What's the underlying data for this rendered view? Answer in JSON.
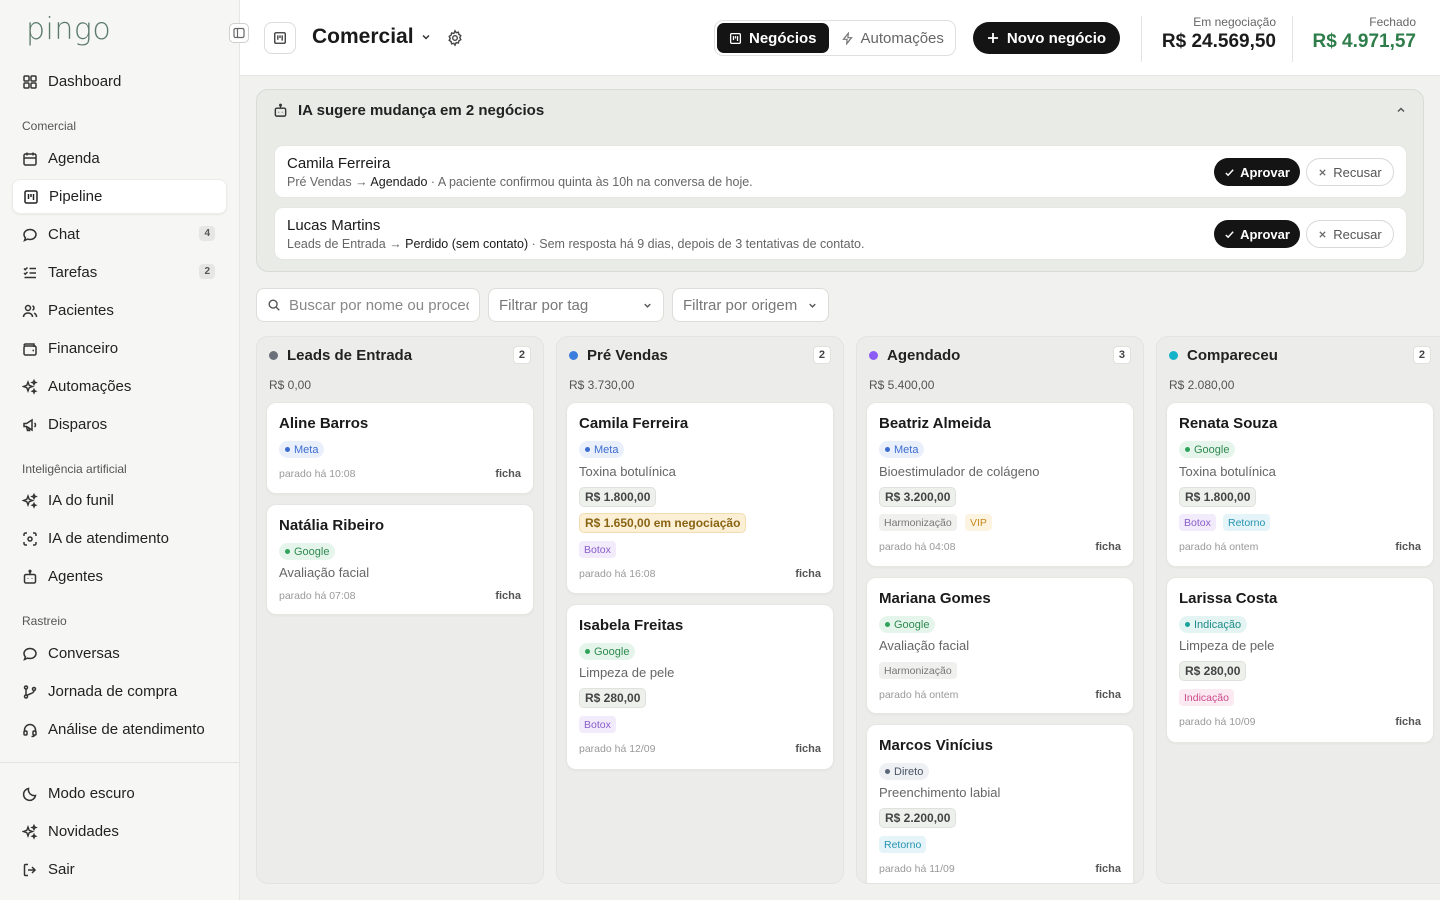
{
  "sidebar": {
    "logo": "pingo",
    "dashboard": "Dashboard",
    "sections": {
      "comercial": "Comercial",
      "ia": "Inteligência artificial",
      "rastreio": "Rastreio"
    },
    "comercial_items": [
      {
        "label": "Agenda",
        "icon": "calendar-icon"
      },
      {
        "label": "Pipeline",
        "icon": "kanban-icon",
        "active": true
      },
      {
        "label": "Chat",
        "icon": "chat-icon",
        "badge": "4"
      },
      {
        "label": "Tarefas",
        "icon": "list-check-icon",
        "badge": "2"
      },
      {
        "label": "Pacientes",
        "icon": "users-icon"
      },
      {
        "label": "Financeiro",
        "icon": "wallet-icon"
      },
      {
        "label": "Automações",
        "icon": "sparkles-icon"
      },
      {
        "label": "Disparos",
        "icon": "megaphone-icon"
      }
    ],
    "ia_items": [
      {
        "label": "IA do funil",
        "icon": "sparkles-icon"
      },
      {
        "label": "IA de atendimento",
        "icon": "scan-face-icon"
      },
      {
        "label": "Agentes",
        "icon": "bot-icon"
      }
    ],
    "rastreio_items": [
      {
        "label": "Conversas",
        "icon": "chat-icon"
      },
      {
        "label": "Jornada de compra",
        "icon": "git-branch-icon"
      },
      {
        "label": "Análise de atendimento",
        "icon": "headset-icon"
      }
    ],
    "footer_items": [
      {
        "label": "Modo escuro",
        "icon": "moon-icon"
      },
      {
        "label": "Novidades",
        "icon": "sparkles-icon"
      },
      {
        "label": "Sair",
        "icon": "logout-icon"
      }
    ]
  },
  "header": {
    "title": "Comercial",
    "tabs": {
      "negocios": "Negócios",
      "automacoes": "Automações"
    },
    "new_button": "Novo negócio",
    "metrics": {
      "negotiation_label": "Em negociação",
      "negotiation_value": "R$ 24.569,50",
      "closed_label": "Fechado",
      "closed_value": "R$ 4.971,57",
      "closed_color": "#2e7d4a"
    }
  },
  "ai_panel": {
    "title": "IA sugere mudança em 2 negócios",
    "approve_label": "Aprovar",
    "reject_label": "Recusar",
    "arrow": "→",
    "suggestions": [
      {
        "name": "Camila Ferreira",
        "from": "Pré Vendas",
        "to": "Agendado",
        "reason": " · A paciente confirmou quinta às 10h na conversa de hoje."
      },
      {
        "name": "Lucas Martins",
        "from": "Leads de Entrada",
        "to": "Perdido (sem contato)",
        "reason": " · Sem resposta há 9 dias, depois de 3 tentativas de contato."
      }
    ]
  },
  "filters": {
    "search_placeholder": "Buscar por nome ou procedimento",
    "tag_label": "Filtrar por tag",
    "origin_label": "Filtrar por origem"
  },
  "ficha_label": "ficha",
  "columns": [
    {
      "title": "Leads de Entrada",
      "count": "2",
      "total": "R$ 0,00",
      "color": "#6b6f7a",
      "cards": [
        {
          "name": "Aline Barros",
          "source": "Meta",
          "stale": "parado há 10:08"
        },
        {
          "name": "Natália Ribeiro",
          "source": "Google",
          "procedure": "Avaliação facial",
          "stale": "parado há 07:08"
        }
      ]
    },
    {
      "title": "Pré Vendas",
      "count": "2",
      "total": "R$ 3.730,00",
      "color": "#3b7ddd",
      "cards": [
        {
          "name": "Camila Ferreira",
          "source": "Meta",
          "procedure": "Toxina botulínica",
          "price": "R$ 1.800,00",
          "negotiation": "R$ 1.650,00 em negociação",
          "tags": [
            "Botox"
          ],
          "stale": "parado há 16:08"
        },
        {
          "name": "Isabela Freitas",
          "source": "Google",
          "procedure": "Limpeza de pele",
          "price": "R$ 280,00",
          "tags": [
            "Botox"
          ],
          "stale": "parado há 12/09"
        }
      ]
    },
    {
      "title": "Agendado",
      "count": "3",
      "total": "R$ 5.400,00",
      "color": "#8b5cf6",
      "cards": [
        {
          "name": "Beatriz Almeida",
          "source": "Meta",
          "procedure": "Bioestimulador de colágeno",
          "price": "R$ 3.200,00",
          "tags": [
            "Harmonização",
            "VIP"
          ],
          "stale": "parado há 04:08"
        },
        {
          "name": "Mariana Gomes",
          "source": "Google",
          "procedure": "Avaliação facial",
          "tags": [
            "Harmonização"
          ],
          "stale": "parado há ontem"
        },
        {
          "name": "Marcos Vinícius",
          "source": "Direto",
          "procedure": "Preenchimento labial",
          "price": "R$ 2.200,00",
          "tags": [
            "Retorno"
          ],
          "stale": "parado há 11/09"
        }
      ]
    },
    {
      "title": "Compareceu",
      "count": "2",
      "total": "R$ 2.080,00",
      "color": "#14b3c9",
      "cards": [
        {
          "name": "Renata Souza",
          "source": "Google",
          "procedure": "Toxina botulínica",
          "price": "R$ 1.800,00",
          "tags": [
            "Botox",
            "Retorno"
          ],
          "stale": "parado há ontem"
        },
        {
          "name": "Larissa Costa",
          "source": "Indicação",
          "procedure": "Limpeza de pele",
          "price": "R$ 280,00",
          "tags": [
            "Indicação"
          ],
          "stale": "parado há 10/09"
        }
      ]
    }
  ]
}
